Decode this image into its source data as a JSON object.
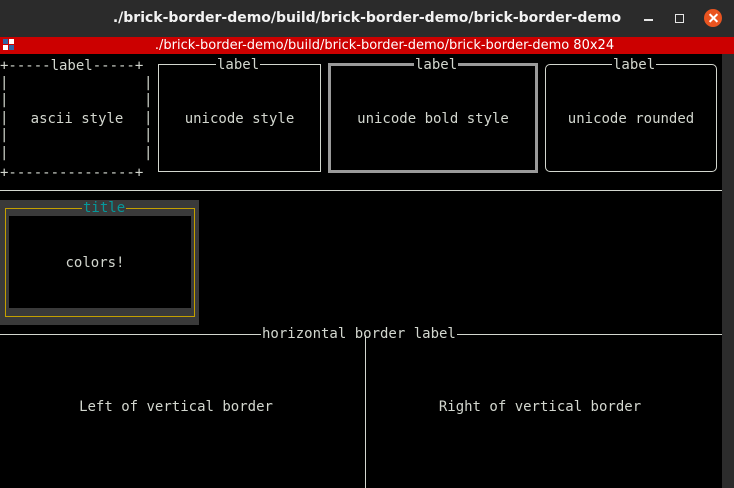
{
  "window": {
    "title": "./brick-border-demo/build/brick-border-demo/brick-border-demo",
    "tab_title": "./brick-border-demo/build/brick-border-demo/brick-border-demo 80x24"
  },
  "boxes": {
    "ascii": {
      "top": "+-----label-----+",
      "side": "|",
      "bottom": "+---------------+",
      "content": "ascii style"
    },
    "unicode": {
      "label": "label",
      "content": "unicode style"
    },
    "bold": {
      "label": "label",
      "content": "unicode bold style"
    },
    "rounded": {
      "label": "label",
      "content": "unicode rounded"
    },
    "colors": {
      "label": "title",
      "content": "colors!"
    }
  },
  "horizontal_label": "horizontal border label",
  "left_text": "Left of vertical border",
  "right_text": "Right of vertical border",
  "colors": {
    "tab_red": "#cc0000",
    "close_orange": "#e95420",
    "terminal_fg": "#d3d7cf",
    "title_cyan": "#06989a",
    "yellow_border": "#c4a000",
    "gray_bg": "#3a3a3a"
  }
}
